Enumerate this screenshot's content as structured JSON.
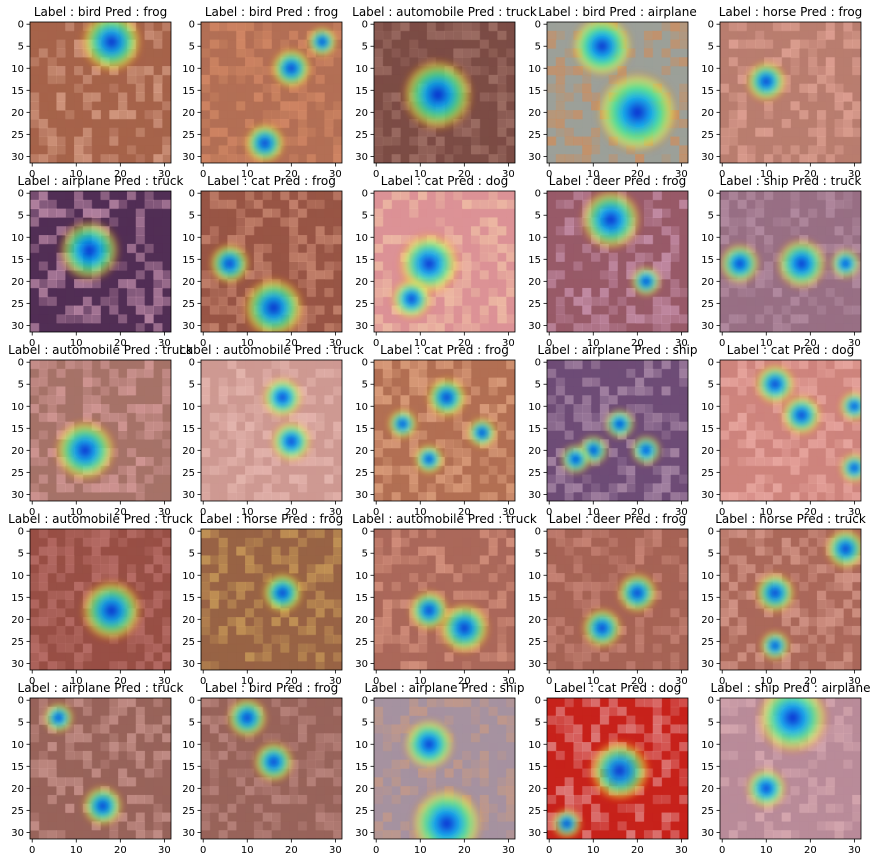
{
  "chart_data": {
    "type": "heatmap",
    "description_ticks": null,
    "ticks": {
      "x": [
        0,
        10,
        20,
        30
      ],
      "y": [
        0,
        5,
        10,
        15,
        20,
        25,
        30
      ],
      "xlim": [
        -0.5,
        31.5
      ],
      "ylim": [
        31.5,
        -0.5
      ]
    },
    "panels": [
      {
        "title": "Label : bird Pred : frog",
        "base": "#9a6a4e",
        "accent": "#d8b59a",
        "hotspots": [
          [
            18,
            4,
            6
          ]
        ]
      },
      {
        "title": "Label : bird Pred : frog",
        "base": "#a9785a",
        "accent": "#d49a70",
        "hotspots": [
          [
            20,
            10,
            4
          ],
          [
            27,
            4,
            3
          ],
          [
            14,
            27,
            4
          ]
        ]
      },
      {
        "title": "Label : automobile Pred : truck",
        "base": "#6a5048",
        "accent": "#9a8074",
        "hotspots": [
          [
            14,
            16,
            7
          ]
        ]
      },
      {
        "title": "Label : bird Pred : airplane",
        "base": "#8fb0a8",
        "accent": "#c99a62",
        "hotspots": [
          [
            12,
            5,
            6
          ],
          [
            20,
            20,
            8
          ]
        ]
      },
      {
        "title": "Label : horse Pred : frog",
        "base": "#b08878",
        "accent": "#e2b8a8",
        "hotspots": [
          [
            10,
            13,
            4
          ]
        ]
      },
      {
        "title": "Label : airplane Pred : truck",
        "base": "#3a2e5a",
        "accent": "#c8a8c8",
        "hotspots": [
          [
            13,
            13,
            6
          ]
        ]
      },
      {
        "title": "Label : cat Pred : frog",
        "base": "#8a5a48",
        "accent": "#c89a80",
        "hotspots": [
          [
            16,
            26,
            6
          ],
          [
            6,
            16,
            4
          ]
        ]
      },
      {
        "title": "Label : cat Pred : dog",
        "base": "#d8a0a4",
        "accent": "#f0d8b8",
        "hotspots": [
          [
            12,
            16,
            6
          ],
          [
            8,
            24,
            4
          ]
        ]
      },
      {
        "title": "Label : deer Pred : frog",
        "base": "#8a6070",
        "accent": "#c8a8c8",
        "hotspots": [
          [
            14,
            6,
            6
          ],
          [
            22,
            20,
            3
          ]
        ]
      },
      {
        "title": "Label : ship Pred : truck",
        "base": "#8a7890",
        "accent": "#b0a0b8",
        "hotspots": [
          [
            4,
            16,
            4
          ],
          [
            18,
            16,
            5
          ],
          [
            28,
            16,
            3
          ]
        ]
      },
      {
        "title": "Label : automobile Pred : truck",
        "base": "#9a7c70",
        "accent": "#d8b0b0",
        "hotspots": [
          [
            12,
            20,
            6
          ]
        ]
      },
      {
        "title": "Label : automobile Pred : truck",
        "base": "#c8a8a0",
        "accent": "#e8d0c8",
        "hotspots": [
          [
            18,
            8,
            4
          ],
          [
            20,
            18,
            4
          ]
        ]
      },
      {
        "title": "Label : cat Pred : frog",
        "base": "#a87858",
        "accent": "#e0b890",
        "hotspots": [
          [
            16,
            8,
            4
          ],
          [
            6,
            14,
            3
          ],
          [
            24,
            16,
            3
          ],
          [
            12,
            22,
            3
          ]
        ]
      },
      {
        "title": "Label : airplane Pred : ship",
        "base": "#5a5080",
        "accent": "#a8a0c0",
        "hotspots": [
          [
            16,
            14,
            3
          ],
          [
            22,
            20,
            3
          ],
          [
            10,
            20,
            3
          ],
          [
            6,
            22,
            3
          ]
        ]
      },
      {
        "title": "Label : cat Pred : dog",
        "base": "#c89088",
        "accent": "#ecc0b8",
        "hotspots": [
          [
            12,
            5,
            4
          ],
          [
            18,
            12,
            4
          ],
          [
            30,
            10,
            3
          ],
          [
            30,
            24,
            3
          ]
        ]
      },
      {
        "title": "Label : automobile Pred : truck",
        "base": "#8a5448",
        "accent": "#b8807a",
        "hotspots": [
          [
            18,
            18,
            6
          ]
        ]
      },
      {
        "title": "Label : horse Pred : frog",
        "base": "#8a6a48",
        "accent": "#c8b060",
        "hotspots": [
          [
            18,
            14,
            4
          ]
        ]
      },
      {
        "title": "Label : automobile Pred : truck",
        "base": "#a07060",
        "accent": "#d8a890",
        "hotspots": [
          [
            20,
            22,
            5
          ],
          [
            12,
            18,
            4
          ]
        ]
      },
      {
        "title": "Label : deer Pred : frog",
        "base": "#9a6a5a",
        "accent": "#c89888",
        "hotspots": [
          [
            20,
            14,
            4
          ],
          [
            12,
            22,
            4
          ]
        ]
      },
      {
        "title": "Label : horse Pred : truck",
        "base": "#a07060",
        "accent": "#d8b0a0",
        "hotspots": [
          [
            28,
            4,
            4
          ],
          [
            12,
            14,
            4
          ],
          [
            12,
            26,
            3
          ]
        ]
      },
      {
        "title": "Label : airplane Pred : truck",
        "base": "#8a6a60",
        "accent": "#c8a8a0",
        "hotspots": [
          [
            16,
            24,
            4
          ],
          [
            6,
            4,
            3
          ]
        ]
      },
      {
        "title": "Label : bird Pred : frog",
        "base": "#8a6a60",
        "accent": "#b89890",
        "hotspots": [
          [
            10,
            4,
            4
          ],
          [
            16,
            14,
            4
          ]
        ]
      },
      {
        "title": "Label : airplane Pred : ship",
        "base": "#9aa0b0",
        "accent": "#c0a890",
        "hotspots": [
          [
            12,
            10,
            5
          ],
          [
            16,
            28,
            7
          ]
        ]
      },
      {
        "title": "Label : cat Pred : dog",
        "base": "#c02018",
        "accent": "#e0a0a0",
        "hotspots": [
          [
            16,
            16,
            6
          ],
          [
            4,
            28,
            3
          ]
        ]
      },
      {
        "title": "Label : ship Pred : airplane",
        "base": "#b098a8",
        "accent": "#d8c0c8",
        "hotspots": [
          [
            16,
            4,
            7
          ],
          [
            10,
            20,
            4
          ]
        ]
      }
    ]
  }
}
